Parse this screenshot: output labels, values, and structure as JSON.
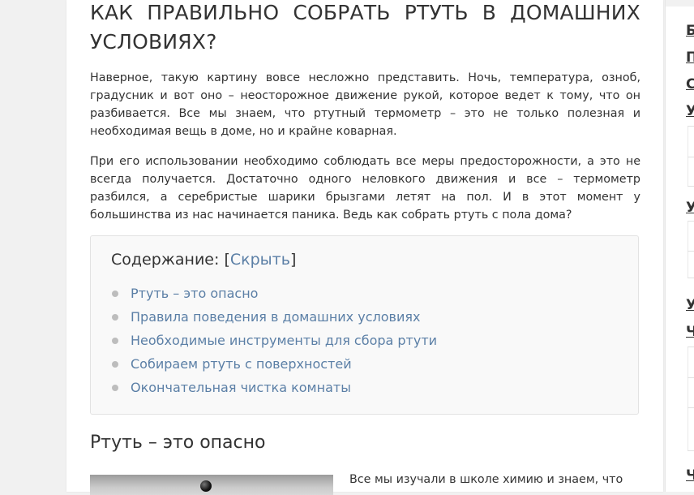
{
  "article": {
    "title": "КАК ПРАВИЛЬНО СОБРАТЬ РТУТЬ В ДОМАШНИХ УСЛОВИЯХ?",
    "paragraphs": [
      "Наверное, такую картину вовсе несложно представить. Ночь, температура, озноб, градусник и вот оно – неосторожное движение рукой, которое ведет к тому, что он разбивается. Все мы знаем, что ртутный термометр – это не только полезная и необходимая вещь в доме, но и крайне коварная.",
      "При его использовании необходимо соблюдать все меры предосторожности, а это не всегда получается. Достаточно одного неловкого движения и все – термометр разбился, а серебристые шарики брызгами летят на пол. И в этот момент у большинства из нас начинается паника. Ведь как собрать ртуть с пола дома?"
    ]
  },
  "toc": {
    "title": "Содержание: ",
    "bracket_open": "[",
    "toggle_label": "Скрыть",
    "bracket_close": "]",
    "items": [
      "Ртуть – это опасно",
      "Правила поведения в домашних условиях",
      "Необходимые инструменты для сбора ртути",
      "Собираем ртуть с поверхностей",
      "Окончательная чистка комнаты"
    ]
  },
  "section": {
    "heading": "Ртуть – это опасно",
    "text": "Все мы изучали в школе химию и знаем, что"
  },
  "sidebar": {
    "letters": [
      "Б",
      "П",
      "С",
      "У",
      "У",
      "У",
      "Ч",
      "Ч"
    ]
  },
  "colors": {
    "link": "#5b7fa6",
    "text": "#333333",
    "page_bg": "#f1f1f1",
    "toc_bg": "#f9f9f9"
  }
}
